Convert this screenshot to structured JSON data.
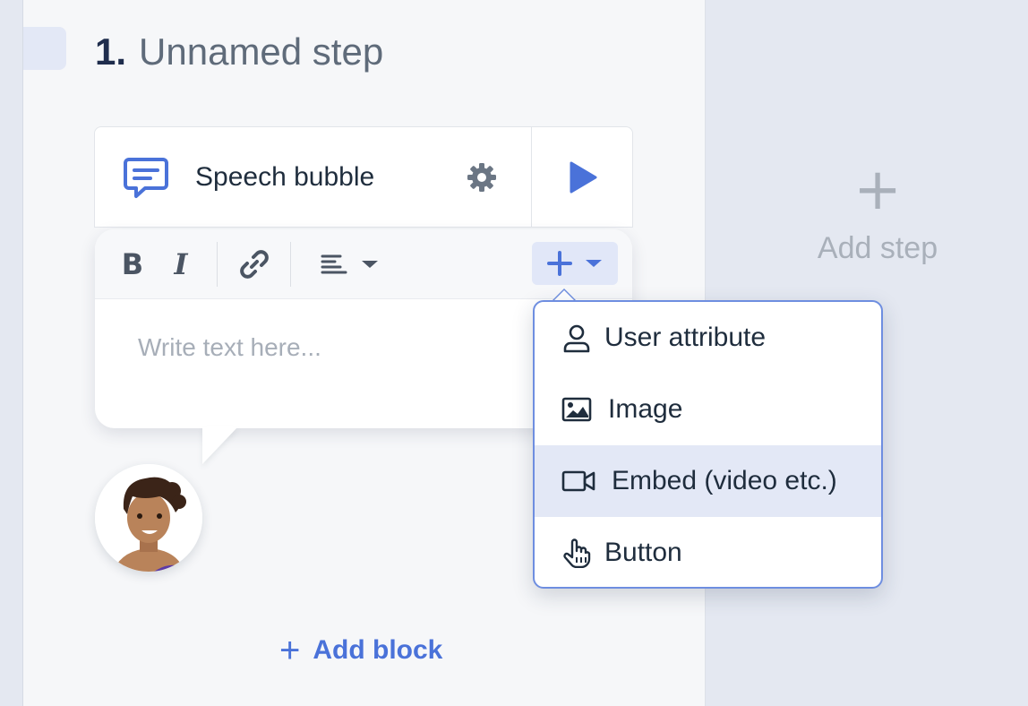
{
  "step": {
    "number": "1.",
    "name": "Unnamed step"
  },
  "block": {
    "type_label": "Speech bubble",
    "icon": "speech-bubble-icon"
  },
  "toolbar": {
    "bold_label": "B",
    "italic_label": "I",
    "link_icon": "link-icon",
    "align_icon": "align-left-icon",
    "insert_icon": "plus-icon"
  },
  "editor": {
    "placeholder": "Write text here..."
  },
  "insert_menu": {
    "items": [
      {
        "label": "User attribute",
        "icon": "user-icon"
      },
      {
        "label": "Image",
        "icon": "image-icon"
      },
      {
        "label": "Embed (video etc.)",
        "icon": "video-icon",
        "highlighted": true
      },
      {
        "label": "Button",
        "icon": "pointer-hand-icon"
      }
    ]
  },
  "add_block_label": "Add block",
  "add_step_label": "Add step",
  "colors": {
    "accent": "#4a72d9",
    "menu_border": "#6e8ee0",
    "highlight": "#e3e8f6"
  }
}
